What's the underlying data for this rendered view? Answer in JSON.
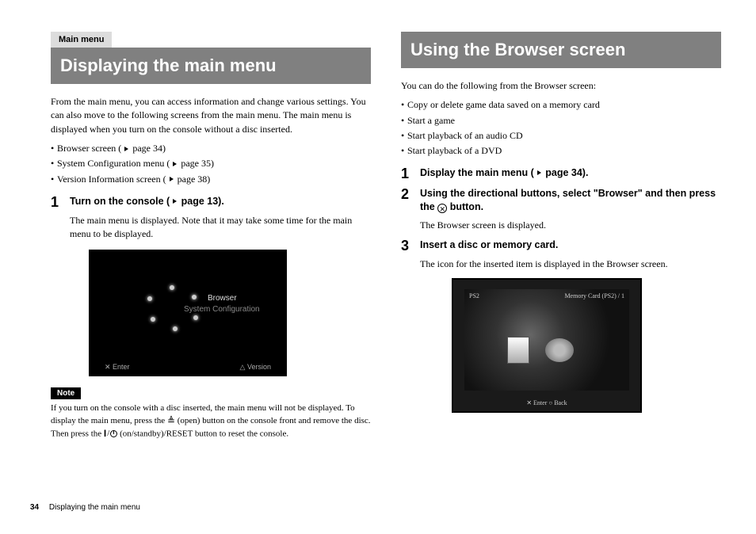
{
  "left": {
    "tab": "Main menu",
    "heading": "Displaying the main menu",
    "intro": "From the main menu, you can access information and change various settings. You can also move to the following screens from the main menu. The main menu is displayed when you turn on the console without a disc inserted.",
    "menu_items": [
      {
        "label": "Browser screen (",
        "page": " page 34)"
      },
      {
        "label": "System Configuration menu (",
        "page": " page 35)"
      },
      {
        "label": "Version Information screen (",
        "page": " page 38)"
      }
    ],
    "step1": {
      "num": "1",
      "title_a": "Turn on the console (",
      "title_b": " page 13).",
      "body": "The main menu is displayed. Note that it may take some time for the main menu to be displayed."
    },
    "shot": {
      "browser": "Browser",
      "syscfg": "System Configuration",
      "enter": "✕ Enter",
      "version": "△ Version"
    },
    "note_tag": "Note",
    "note_a": "If you turn on the console with a disc inserted, the main menu will not be displayed. To display the main menu, press the ",
    "note_b": " (open) button on the console front and remove the disc. Then press the ",
    "note_c": " (on/standby)/RESET button to reset the console."
  },
  "right": {
    "heading": "Using the Browser screen",
    "intro": "You can do the following from the Browser screen:",
    "features": [
      "Copy or delete game data saved on a memory card",
      "Start a game",
      "Start playback of an audio CD",
      "Start playback of a DVD"
    ],
    "step1": {
      "num": "1",
      "title_a": "Display the main menu (",
      "title_b": " page 34)."
    },
    "step2": {
      "num": "2",
      "title_a": "Using the directional buttons, select \"Browser\" and then press the ",
      "title_b": " button.",
      "body": "The Browser screen is displayed."
    },
    "step3": {
      "num": "3",
      "title": "Insert a disc or memory card.",
      "body": "The icon for the inserted item is displayed in the Browser screen."
    },
    "shot": {
      "tl": "PS2",
      "tr": "Memory Card (PS2) / 1",
      "foot": "✕ Enter    ○ Back"
    }
  },
  "footer": {
    "page_num": "34",
    "title": "Displaying the main menu"
  }
}
